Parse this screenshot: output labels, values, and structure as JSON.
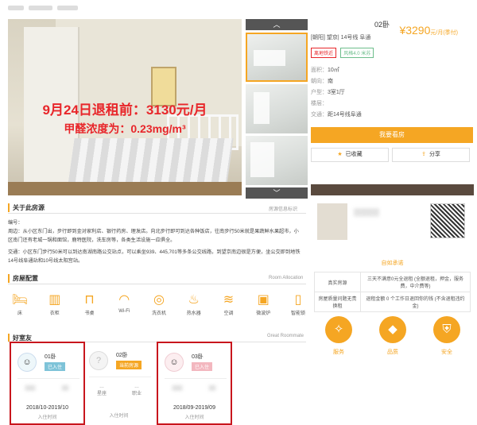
{
  "listing": {
    "title_suffix": "02卧",
    "price": "¥3290",
    "price_unit": "元/月(季付)",
    "location": "[朝阳] 望京| 14号线 阜通",
    "tags": [
      "离地铁近",
      "风格4.0 米苏"
    ],
    "attrs": [
      {
        "k": "面积：",
        "v": "10㎡"
      },
      {
        "k": "朝向：",
        "v": "南"
      },
      {
        "k": "户型：",
        "v": "3室1厅"
      },
      {
        "k": "楼层：",
        "v": ""
      },
      {
        "k": "交通：",
        "v": "距14号线阜通"
      }
    ],
    "book_label": "我要看房",
    "collect_label": "已收藏",
    "share_label": "分享"
  },
  "photo_overlay": {
    "line1": "9月24日退租前：3130元/月",
    "line2": "甲醛浓度为：0.23mg/m³"
  },
  "about": {
    "title": "关于此房源",
    "subtitle": "房源信息标识",
    "line1": "编号：",
    "line2": "周边：从小区东门出，步行即到金对家利店、银行药房、理发店。向北步行即可到达各种饭店，往南步行50米就是果蔬鲜水果超市，小区南门还有老城一锅和面馆，鹿特医院，洗车房等，各类生活设施一应俱全。",
    "line3": "交通：小区东门步行50米可以到达南湖南路公交站点，可以乘坐939、445,701等多条公交线路，到望京南边很是方便，坐公交即到地铁14号线阜通站和10号线太阳宫站。"
  },
  "config": {
    "title": "房屋配置",
    "subtitle": "Room Allocation",
    "items": [
      {
        "label": "床",
        "icon": "bed-icon",
        "glyph": "🛏"
      },
      {
        "label": "衣柜",
        "icon": "wardrobe-icon",
        "glyph": "▥"
      },
      {
        "label": "书桌",
        "icon": "desk-icon",
        "glyph": "⊓"
      },
      {
        "label": "Wi-Fi",
        "icon": "wifi-icon",
        "glyph": "◠"
      },
      {
        "label": "洗衣机",
        "icon": "washer-icon",
        "glyph": "◎"
      },
      {
        "label": "热水器",
        "icon": "water-heater-icon",
        "glyph": "♨"
      },
      {
        "label": "空调",
        "icon": "ac-icon",
        "glyph": "≋"
      },
      {
        "label": "微波炉",
        "icon": "microwave-icon",
        "glyph": "▣"
      },
      {
        "label": "智能锁",
        "icon": "smart-lock-icon",
        "glyph": "▯"
      }
    ]
  },
  "roommates": {
    "title": "好室友",
    "subtitle": "Great Roommate",
    "items": [
      {
        "room": "01卧",
        "status": "已入住",
        "date": "2018/10-2019/10",
        "date_label": "入住时间",
        "p1": "",
        "p2": ""
      },
      {
        "room": "02卧",
        "status": "当前房源",
        "date": "",
        "date_label": "入住时间",
        "p1": "星座",
        "p2": "职业"
      },
      {
        "room": "03卧",
        "status": "已入住",
        "date": "2018/09-2019/09",
        "date_label": "入住时间",
        "p1": "",
        "p2": ""
      }
    ]
  },
  "agent": {
    "slogan": "自如承诺",
    "rows": [
      [
        "真实房源",
        "三天不满意0元全退租 (全额退租，押金，服务费，中介费等)"
      ],
      [
        "房屋质量问题无责换租",
        "退租金额 0 个工作日退回你的钱 (不含退租违约金)"
      ]
    ],
    "services": [
      "服务",
      "品质",
      "安全"
    ]
  },
  "colors": {
    "accent": "#f5a623",
    "highlight": "#c8161d",
    "overlay_text": "#e8262a"
  }
}
